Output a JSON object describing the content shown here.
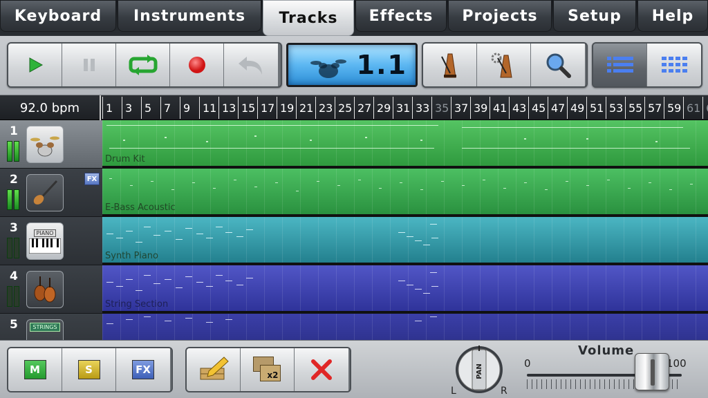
{
  "tabs": [
    {
      "label": "Keyboard"
    },
    {
      "label": "Instruments"
    },
    {
      "label": "Tracks",
      "active": true
    },
    {
      "label": "Effects"
    },
    {
      "label": "Projects"
    },
    {
      "label": "Setup"
    },
    {
      "label": "Help"
    }
  ],
  "transport": {
    "lcd_value": "1.1",
    "icons": [
      "play-icon",
      "pause-icon",
      "loop-icon",
      "record-icon",
      "undo-icon"
    ]
  },
  "toolbar_icons": [
    "metronome-icon",
    "metronome-settings-icon",
    "zoom-magnifier-icon",
    "list-view-icon",
    "grid-view-icon"
  ],
  "ruler": {
    "tempo": "92.0 bpm",
    "bars": [
      "1",
      "3",
      "5",
      "7",
      "9",
      "11",
      "13",
      "15",
      "17",
      "19",
      "21",
      "23",
      "25",
      "27",
      "29",
      "31",
      "33",
      "35",
      "37",
      "39",
      "41",
      "43",
      "45",
      "47",
      "49",
      "51",
      "53",
      "55",
      "57",
      "59",
      "61",
      "6"
    ]
  },
  "tracks": [
    {
      "number": "1",
      "name": "Drum Kit",
      "icon": "drum-kit-icon",
      "color": "#3aa84a",
      "fx": false,
      "selected": true
    },
    {
      "number": "2",
      "name": "E-Bass Acoustic",
      "icon": "bass-guitar-icon",
      "color": "#2fa453",
      "fx": true,
      "fx_label": "FX",
      "selected": false
    },
    {
      "number": "3",
      "name": "Synth Piano",
      "icon": "piano-icon",
      "icon_text": "PIANO",
      "color": "#2a95a4",
      "fx": false,
      "selected": false
    },
    {
      "number": "4",
      "name": "String Section",
      "icon": "strings-icon",
      "color": "#3a3aa6",
      "fx": false,
      "selected": false
    },
    {
      "number": "5",
      "name": "",
      "icon": "strings-label-icon",
      "icon_text": "STRINGS",
      "color": "#2c2f86",
      "fx": false,
      "selected": false
    }
  ],
  "bottom": {
    "mute_label": "M",
    "solo_label": "S",
    "fx_label": "FX",
    "edit_icon": "edit-pencil-icon",
    "duplicate_label": "x2",
    "delete_icon": "delete-x-icon",
    "pan": {
      "label": "PAN",
      "left": "L",
      "right": "R"
    },
    "volume": {
      "label": "Volume",
      "min": "0",
      "max": "100",
      "level": 0.78
    }
  },
  "colors": {
    "accent_green": "#3aa84a",
    "lcd_blue": "#5cb7f2",
    "record_red": "#e02020"
  }
}
